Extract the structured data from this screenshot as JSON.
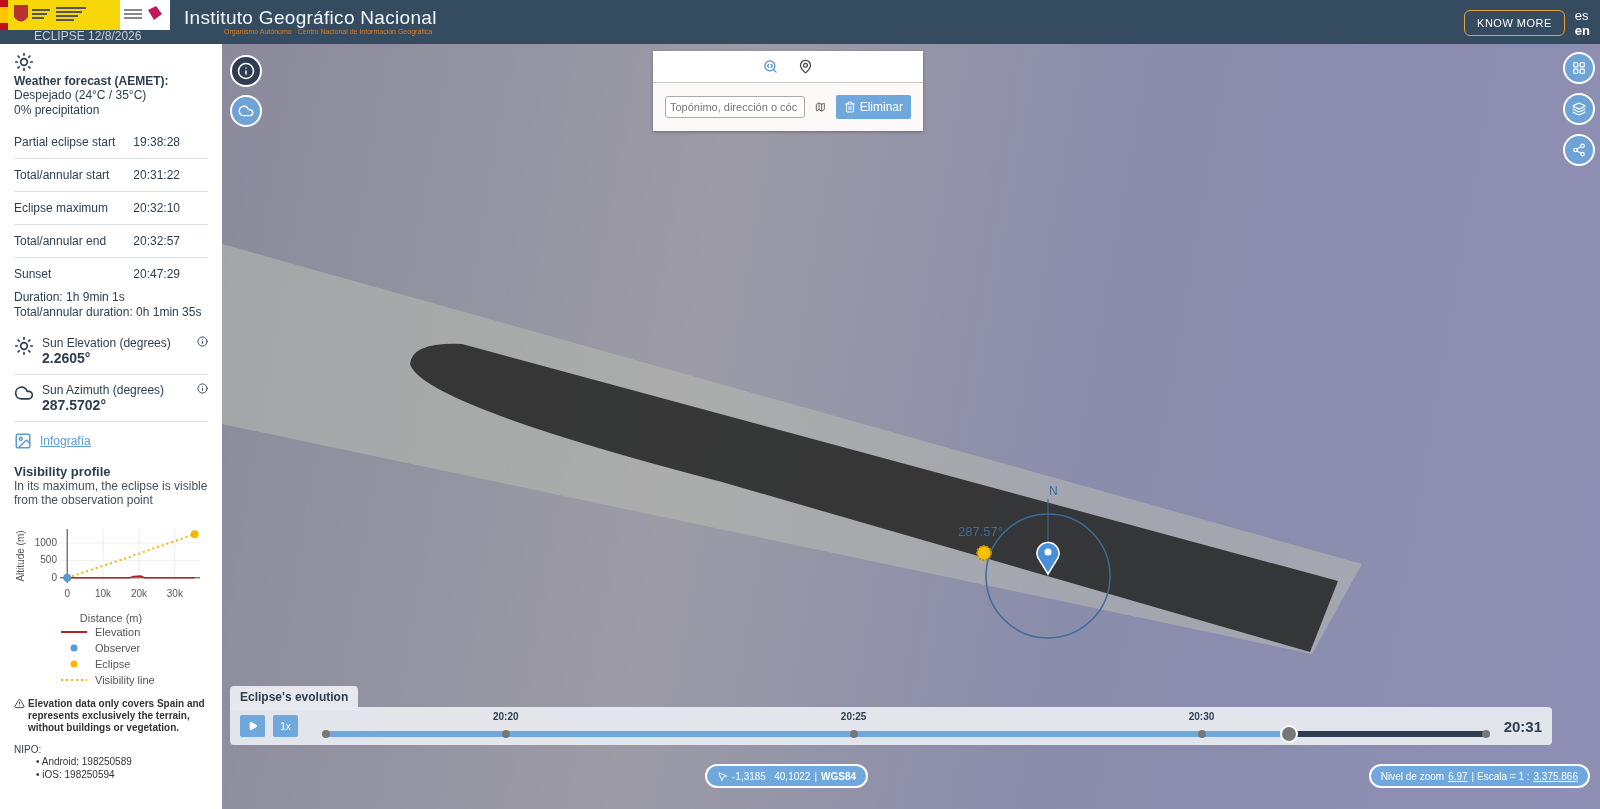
{
  "header": {
    "title": "Instituto Geográfico Nacional",
    "subtitle": "Organismo Autónomo   Centro Nacional de Información Geográfica",
    "app_title": "ECLIPSE 12/8/2026",
    "know_more": "KNOW MORE",
    "languages": [
      {
        "label": "es",
        "selected": false
      },
      {
        "label": "en",
        "selected": true
      }
    ]
  },
  "sidebar": {
    "weather": {
      "title": "Weather forecast (AEMET):",
      "lines": [
        "Despejado (24°C / 35°C)",
        "0% precipitation"
      ]
    },
    "times": [
      {
        "label": "Partial eclipse start",
        "value": "19:38:28"
      },
      {
        "label": "Total/annular start",
        "value": "20:31:22"
      },
      {
        "label": "Eclipse maximum",
        "value": "20:32:10"
      },
      {
        "label": "Total/annular end",
        "value": "20:32:57"
      },
      {
        "label": "Sunset",
        "value": "20:47:29"
      }
    ],
    "durations": [
      "Duration: 1h 9min 1s",
      "Total/annular duration: 0h 1min 35s"
    ],
    "sun_metrics": [
      {
        "kind": "elevation",
        "label": "Sun Elevation (degrees)",
        "value": "2.2605°"
      },
      {
        "kind": "azimuth",
        "label": "Sun Azimuth (degrees)",
        "value": "287.5702°"
      }
    ],
    "link": "Infografía",
    "profile": {
      "title": "Visibility profile",
      "text": "In its maximum, the eclipse is visible from the observation point",
      "chart_data": {
        "type": "line",
        "xlabel": "Distance (m)",
        "ylabel": "Altitude (m)",
        "grid": true,
        "legend": "bottom",
        "x": [
          0,
          17500,
          18500,
          20500,
          21500,
          35500
        ],
        "series": [
          {
            "name": "Elevation",
            "color": "#b22222",
            "values": [
              0,
              0,
              40,
              50,
              0,
              0
            ]
          },
          {
            "name": "Observer",
            "color": "#5b9bd5",
            "marker": "circle",
            "values": [
              0,
              null,
              null,
              null,
              null,
              null
            ]
          },
          {
            "name": "Eclipse",
            "color": "#f5b800",
            "marker": "circle",
            "values": [
              null,
              null,
              null,
              null,
              null,
              1250
            ]
          },
          {
            "name": "Visibility line",
            "color": "#f5b800",
            "line_style": "dotted",
            "values": [
              0,
              600,
              650,
              700,
              750,
              1250
            ]
          }
        ],
        "xlim": [
          -2000,
          37000
        ],
        "ylim": [
          -150,
          1400
        ],
        "xticks": [
          {
            "value": 0,
            "label": "0"
          },
          {
            "value": 10000,
            "label": "10k"
          },
          {
            "value": 20000,
            "label": "20k"
          },
          {
            "value": 30000,
            "label": "30k"
          }
        ],
        "yticks": [
          0,
          500,
          1000
        ]
      }
    },
    "note": "Elevation data only covers Spain and represents exclusively the terrain, without buildings or vegetation.",
    "nipo_label": "NIPO:",
    "nipo_items": [
      "• Android: 198250589",
      "• iOS: 198250594"
    ]
  },
  "map": {
    "search": {
      "tabs": [
        {
          "kind": "search",
          "selected": true
        },
        {
          "kind": "pin",
          "selected": false
        }
      ],
      "placeholder": "Topónimo, dirección o cóc",
      "delete_button": "Eliminar"
    },
    "azimuth_label": "287.57°",
    "north_label": "N",
    "timeline": {
      "title": "Eclipse's evolution",
      "speed": "1x",
      "ticks": [
        "20:20",
        "20:25",
        "20:30"
      ],
      "level": 0.83,
      "current": "20:31"
    },
    "coords": {
      "value": "-1,3185   40,1022",
      "separator": "|",
      "crs": "WGS84"
    },
    "scale": {
      "zoom_label": "Nivel de zoom",
      "zoom": "6.97",
      "scale_label": "| Escala = 1 :",
      "scale": "3.375.866"
    }
  }
}
